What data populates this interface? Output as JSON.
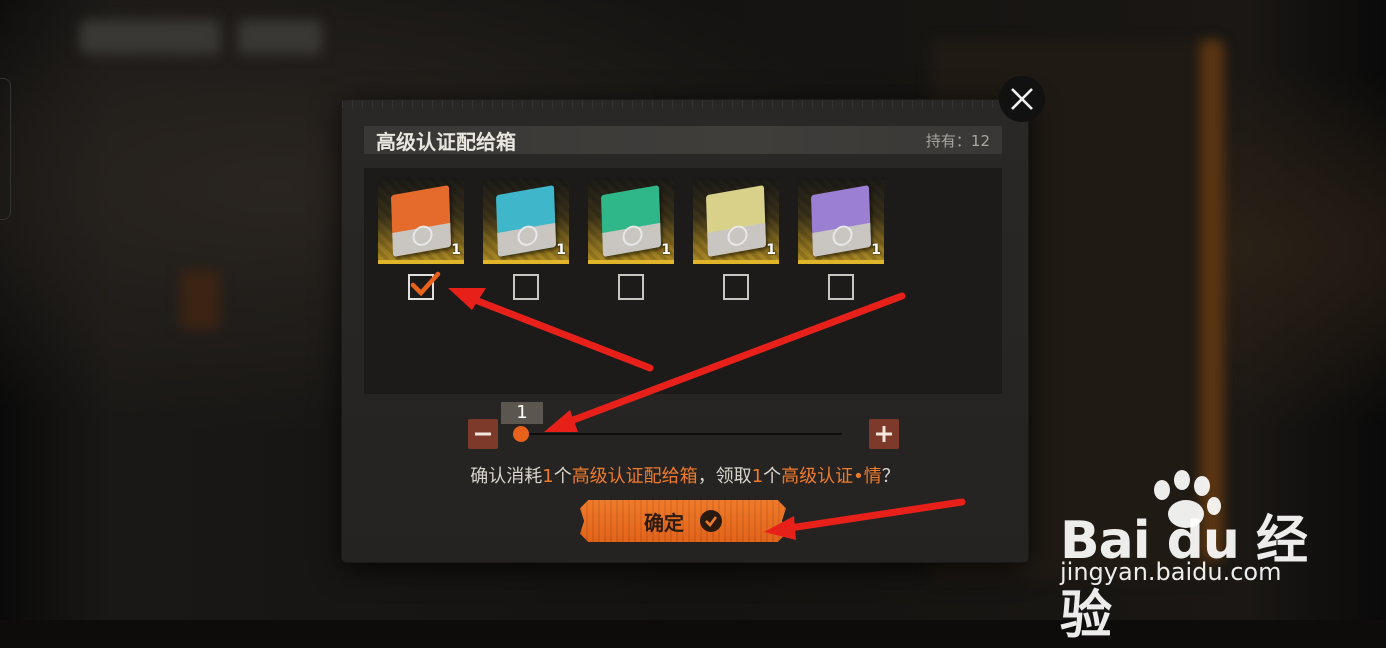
{
  "dialog": {
    "title": "高级认证配给箱",
    "owned_label": "持有：12",
    "close_icon": "close-icon"
  },
  "items": [
    {
      "color": "#e56b2d",
      "count": "1",
      "checked": true
    },
    {
      "color": "#3fb6c9",
      "count": "1",
      "checked": false
    },
    {
      "color": "#2fb78a",
      "count": "1",
      "checked": false
    },
    {
      "color": "#d9d08a",
      "count": "1",
      "checked": false
    },
    {
      "color": "#9a7fd2",
      "count": "1",
      "checked": false
    }
  ],
  "quantity": {
    "value": "1",
    "min_label": "−",
    "max_label": "+",
    "level": 0.0
  },
  "confirm": {
    "prefix": "确认消耗",
    "qty1": "1",
    "mid1": "个",
    "item_name": "高级认证配给箱",
    "mid2": "，领取",
    "qty2": "1",
    "mid3": "个",
    "reward_name": "高级认证•情",
    "suffix": "？"
  },
  "confirm_button": {
    "label": "确定",
    "icon": "check-circle-icon"
  },
  "watermark": {
    "brand": "Bai du 经验",
    "url": "jingyan.baidu.com"
  },
  "colors": {
    "accent": "#e8621c",
    "annotation_arrow": "#e8201a"
  }
}
